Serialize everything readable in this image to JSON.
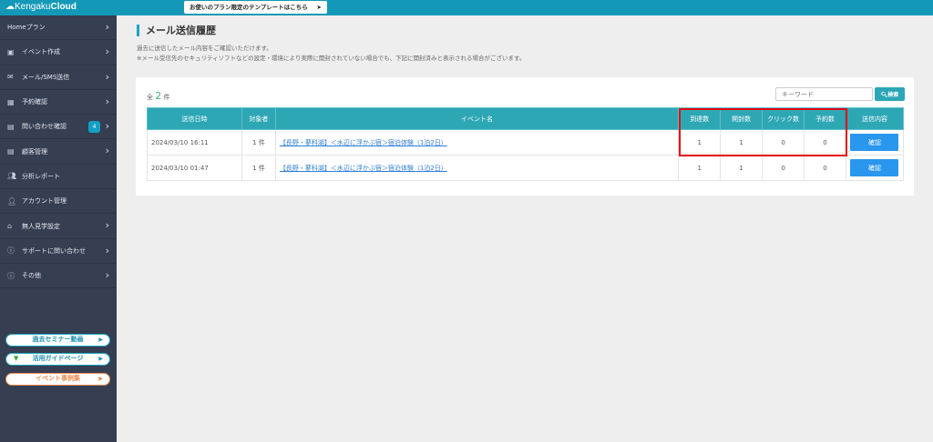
{
  "header": {
    "logo": "Kengaku",
    "logo_bold": "Cloud",
    "template_link": "お使いのプラン限定のテンプレートはこちら"
  },
  "sidebar": {
    "items": [
      {
        "label": "Homeプラン",
        "icon": "",
        "chevron": true
      },
      {
        "label": "イベント作成",
        "icon": "image-icon",
        "chevron": true
      },
      {
        "label": "メール/SMS送信",
        "icon": "mail-icon",
        "chevron": true
      },
      {
        "label": "予約確認",
        "icon": "calendar-icon",
        "chevron": true
      },
      {
        "label": "問い合わせ確認",
        "icon": "id-card-icon",
        "chevron": true,
        "badge": "4"
      },
      {
        "label": "顧客管理",
        "icon": "id-card-icon",
        "chevron": true
      },
      {
        "label": "分析レポート",
        "icon": "users-icon",
        "chevron": false
      },
      {
        "label": "アカウント管理",
        "icon": "user-icon",
        "chevron": false
      },
      {
        "label": "無人見学設定",
        "icon": "home-icon",
        "chevron": true
      },
      {
        "label": "サポートに問い合わせ",
        "icon": "info-icon",
        "chevron": true
      },
      {
        "label": "その他",
        "icon": "info-icon",
        "chevron": true
      }
    ],
    "buttons": [
      "過去セミナー動画",
      "活用ガイドページ",
      "イベント事例集"
    ]
  },
  "main": {
    "title": "メール送信履歴",
    "desc1": "過去に送信したメール内容をご確認いただけます。",
    "desc2": "※メール受信先のセキュリティソフトなどの設定・環境により実際に開封されていない場合でも、下記に開封済みと表示される場合がございます。",
    "count_prefix": "全",
    "count": "2",
    "count_suffix": "件",
    "search": {
      "placeholder": "キーワード",
      "button": "検索"
    },
    "columns": [
      "送信日時",
      "対象者",
      "イベント名",
      "到達数",
      "開封数",
      "クリック数",
      "予約数",
      "送信内容"
    ],
    "rows": [
      {
        "date": "2024/03/10 16:11",
        "target": "1 件",
        "event": "【長野・蓼科湖】＜水辺に浮かぶ宿＞宿泊体験（1泊2日）",
        "reached": "1",
        "opened": "1",
        "clicks": "0",
        "reservations": "0",
        "action": "確認"
      },
      {
        "date": "2024/03/10 01:47",
        "target": "1 件",
        "event": "【長野・蓼科湖】＜水辺に浮かぶ宿＞宿泊体験（1泊2日）",
        "reached": "1",
        "opened": "1",
        "clicks": "0",
        "reservations": "0",
        "action": "確認"
      }
    ]
  },
  "colors": {
    "topbar": "#1399b7",
    "sidebar": "#363e52",
    "table_header": "#2ea7b5",
    "highlight": "#e30613",
    "confirm": "#2a97ee"
  }
}
